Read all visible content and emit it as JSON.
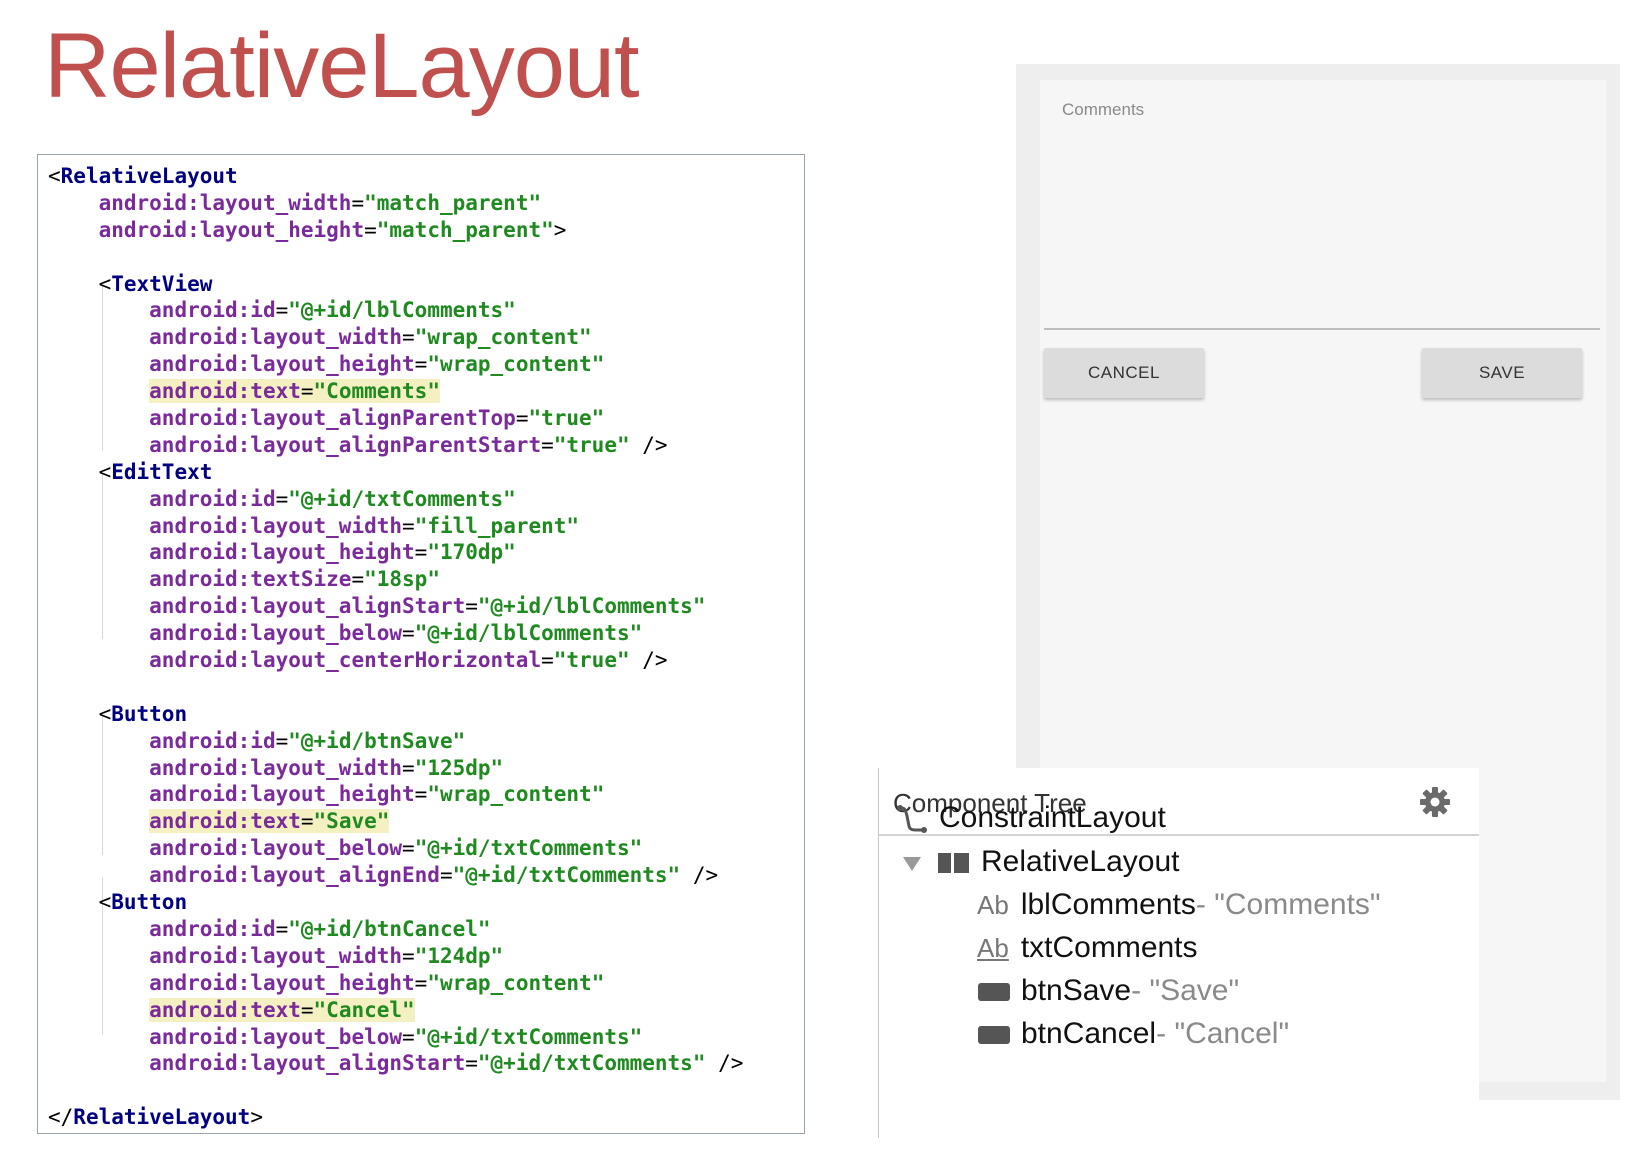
{
  "slide": {
    "title": "RelativeLayout"
  },
  "code": {
    "lines": [
      "<RelativeLayout",
      "android:layout_width=\"match_parent\"",
      "android:layout_height=\"match_parent\">",
      "",
      "<TextView",
      "android:id=\"@+id/lblComments\"",
      "android:layout_width=\"wrap_content\"",
      "android:layout_height=\"wrap_content\"",
      "android:text=\"Comments\"",
      "android:layout_alignParentTop=\"true\"",
      "android:layout_alignParentStart=\"true\" />",
      "<EditText",
      "android:id=\"@+id/txtComments\"",
      "android:layout_width=\"fill_parent\"",
      "android:layout_height=\"170dp\"",
      "android:textSize=\"18sp\"",
      "android:layout_alignStart=\"@+id/lblComments\"",
      "android:layout_below=\"@+id/lblComments\"",
      "android:layout_centerHorizontal=\"true\" />",
      "",
      "<Button",
      "android:id=\"@+id/btnSave\"",
      "android:layout_width=\"125dp\"",
      "android:layout_height=\"wrap_content\"",
      "android:text=\"Save\"",
      "android:layout_below=\"@+id/txtComments\"",
      "android:layout_alignEnd=\"@+id/txtComments\" />",
      "<Button",
      "android:id=\"@+id/btnCancel\"",
      "android:layout_width=\"124dp\"",
      "android:layout_height=\"wrap_content\"",
      "android:text=\"Cancel\"",
      "android:layout_below=\"@+id/txtComments\"",
      "android:layout_alignStart=\"@+id/txtComments\" />",
      "",
      "</RelativeLayout>"
    ]
  },
  "preview": {
    "comments_label": "Comments",
    "cancel_button": "CANCEL",
    "save_button": "SAVE"
  },
  "component_tree": {
    "title": "Component Tree",
    "root": "ConstraintLayout",
    "child": "RelativeLayout",
    "items": [
      {
        "icon": "Ab",
        "name": "lblComments",
        "dash": "-",
        "text": "\"Comments\""
      },
      {
        "icon": "Ab",
        "name": "txtComments",
        "dash": "",
        "text": ""
      },
      {
        "icon": "button-icon",
        "name": "btnSave",
        "dash": "-",
        "text": "\"Save\""
      },
      {
        "icon": "button-icon",
        "name": "btnCancel",
        "dash": "-",
        "text": "\"Cancel\""
      }
    ]
  }
}
